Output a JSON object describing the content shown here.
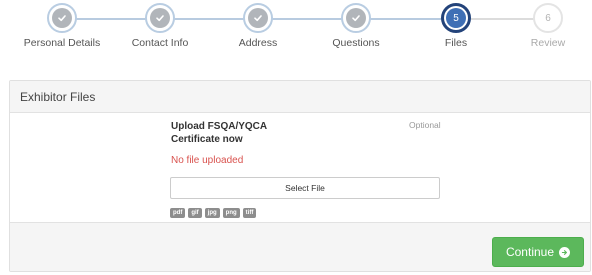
{
  "stepper": {
    "steps": [
      {
        "label": "Personal Details",
        "state": "done",
        "icon": "check-icon"
      },
      {
        "label": "Contact Info",
        "state": "done",
        "icon": "check-icon"
      },
      {
        "label": "Address",
        "state": "done",
        "icon": "check-icon"
      },
      {
        "label": "Questions",
        "state": "done",
        "icon": "check-icon"
      },
      {
        "label": "Files",
        "state": "current",
        "number": "5"
      },
      {
        "label": "Review",
        "state": "todo",
        "number": "6"
      }
    ]
  },
  "panel": {
    "header": "Exhibitor Files",
    "upload": {
      "title": "Upload FSQA/YQCA Certificate now",
      "optional": "Optional",
      "status": "No file uploaded",
      "select_label": "Select File",
      "formats": [
        "pdf",
        "gif",
        "jpg",
        "png",
        "tiff"
      ]
    },
    "footer": {
      "continue_label": "Continue",
      "continue_icon": "arrow-right-circle-icon"
    }
  },
  "colors": {
    "current_step": "#3f6fb5",
    "done_step": "#b1b5ba",
    "error_text": "#d9534f",
    "continue_button": "#5cb85c"
  }
}
